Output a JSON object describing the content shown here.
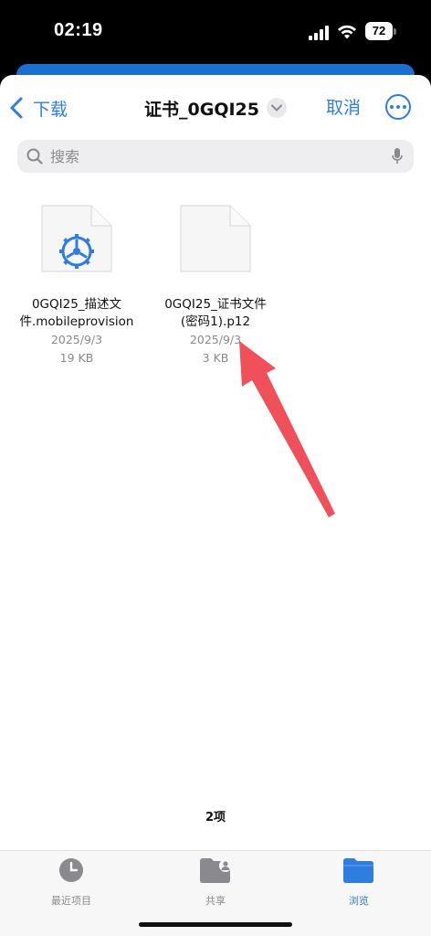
{
  "status_bar": {
    "time": "02:19",
    "battery": "72"
  },
  "nav": {
    "back_label": "下载",
    "title": "证书_0GQI25",
    "cancel_label": "取消"
  },
  "search": {
    "placeholder": "搜索"
  },
  "files": [
    {
      "name_line1": "0GQI25_描述文",
      "name_line2": "件.mobileprovision",
      "date": "2025/9/3",
      "size": "19 KB",
      "icon": "gear-document-icon"
    },
    {
      "name_line1": "0GQI25_证书文件",
      "name_line2": "(密码1).p12",
      "date": "2025/9/3",
      "size": "3 KB",
      "icon": "blank-document-icon"
    }
  ],
  "item_count": "2项",
  "tabs": [
    {
      "label": "最近项目",
      "icon": "clock-icon",
      "active": false
    },
    {
      "label": "共享",
      "icon": "shared-folder-icon",
      "active": false
    },
    {
      "label": "浏览",
      "icon": "folder-icon",
      "active": true
    }
  ],
  "colors": {
    "accent": "#2f7de1",
    "annotation_arrow": "#f0505a"
  }
}
